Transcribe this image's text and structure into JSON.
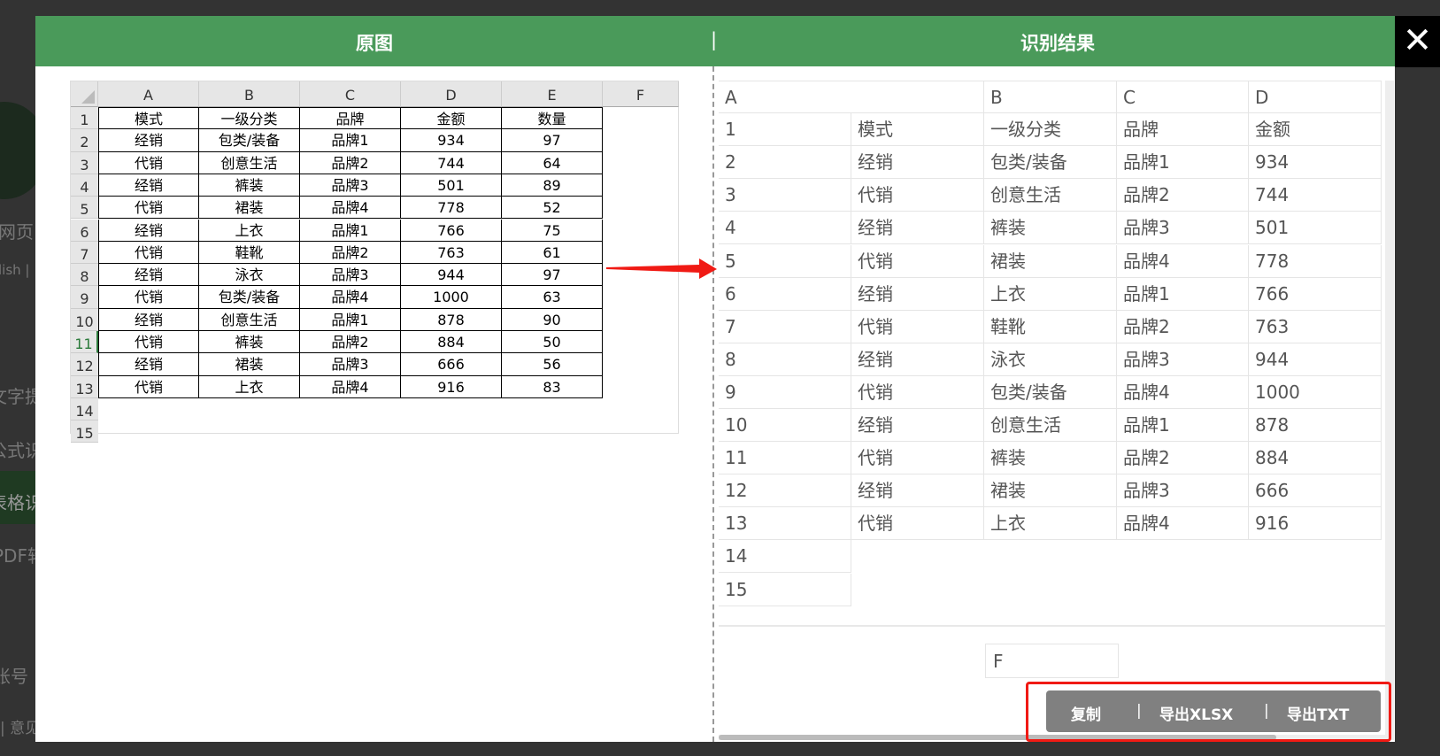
{
  "background": {
    "fragments": [
      "网页",
      "lish |",
      "文字提",
      "公式识",
      "表格识",
      "PDF转",
      "账号",
      "| 意见"
    ]
  },
  "header": {
    "left_title": "原图",
    "divider": "|",
    "right_title": "识别结果",
    "close": "✕"
  },
  "original": {
    "columns": [
      "A",
      "B",
      "C",
      "D",
      "E",
      "F"
    ],
    "row_numbers": [
      "1",
      "2",
      "3",
      "4",
      "5",
      "6",
      "7",
      "8",
      "9",
      "10",
      "11",
      "12",
      "13",
      "14",
      "15"
    ],
    "rows": [
      [
        "模式",
        "一级分类",
        "品牌",
        "金额",
        "数量"
      ],
      [
        "经销",
        "包类/装备",
        "品牌1",
        "934",
        "97"
      ],
      [
        "代销",
        "创意生活",
        "品牌2",
        "744",
        "64"
      ],
      [
        "经销",
        "裤装",
        "品牌3",
        "501",
        "89"
      ],
      [
        "代销",
        "裙装",
        "品牌4",
        "778",
        "52"
      ],
      [
        "经销",
        "上衣",
        "品牌1",
        "766",
        "75"
      ],
      [
        "代销",
        "鞋靴",
        "品牌2",
        "763",
        "61"
      ],
      [
        "经销",
        "泳衣",
        "品牌3",
        "944",
        "97"
      ],
      [
        "代销",
        "包类/装备",
        "品牌4",
        "1000",
        "63"
      ],
      [
        "经销",
        "创意生活",
        "品牌1",
        "878",
        "90"
      ],
      [
        "代销",
        "裤装",
        "品牌2",
        "884",
        "50"
      ],
      [
        "经销",
        "裙装",
        "品牌3",
        "666",
        "56"
      ],
      [
        "代销",
        "上衣",
        "品牌4",
        "916",
        "83"
      ]
    ]
  },
  "result": {
    "header_row": [
      "A",
      "B",
      "C",
      "D"
    ],
    "row_numbers": [
      "1",
      "2",
      "3",
      "4",
      "5",
      "6",
      "7",
      "8",
      "9",
      "10",
      "11",
      "12",
      "13",
      "14",
      "15"
    ],
    "rows": [
      [
        "模式",
        "一级分类",
        "品牌",
        "金额"
      ],
      [
        "经销",
        "包类/装备",
        "品牌1",
        "934"
      ],
      [
        "代销",
        "创意生活",
        "品牌2",
        "744"
      ],
      [
        "经销",
        "裤装",
        "品牌3",
        "501"
      ],
      [
        "代销",
        "裙装",
        "品牌4",
        "778"
      ],
      [
        "经销",
        "上衣",
        "品牌1",
        "766"
      ],
      [
        "代销",
        "鞋靴",
        "品牌2",
        "763"
      ],
      [
        "经销",
        "泳衣",
        "品牌3",
        "944"
      ],
      [
        "代销",
        "包类/装备",
        "品牌4",
        "1000"
      ],
      [
        "经销",
        "创意生活",
        "品牌1",
        "878"
      ],
      [
        "代销",
        "裤装",
        "品牌2",
        "884"
      ],
      [
        "经销",
        "裙装",
        "品牌3",
        "666"
      ],
      [
        "代销",
        "上衣",
        "品牌4",
        "916"
      ]
    ],
    "overflow_cell": "F"
  },
  "actions": {
    "copy": "复制",
    "sep": "|",
    "export_xlsx": "导出XLSX",
    "export_txt": "导出TXT"
  },
  "colors": {
    "header_green": "#4a9a5a",
    "highlight_red": "#f01a14",
    "button_gray": "#808080"
  }
}
